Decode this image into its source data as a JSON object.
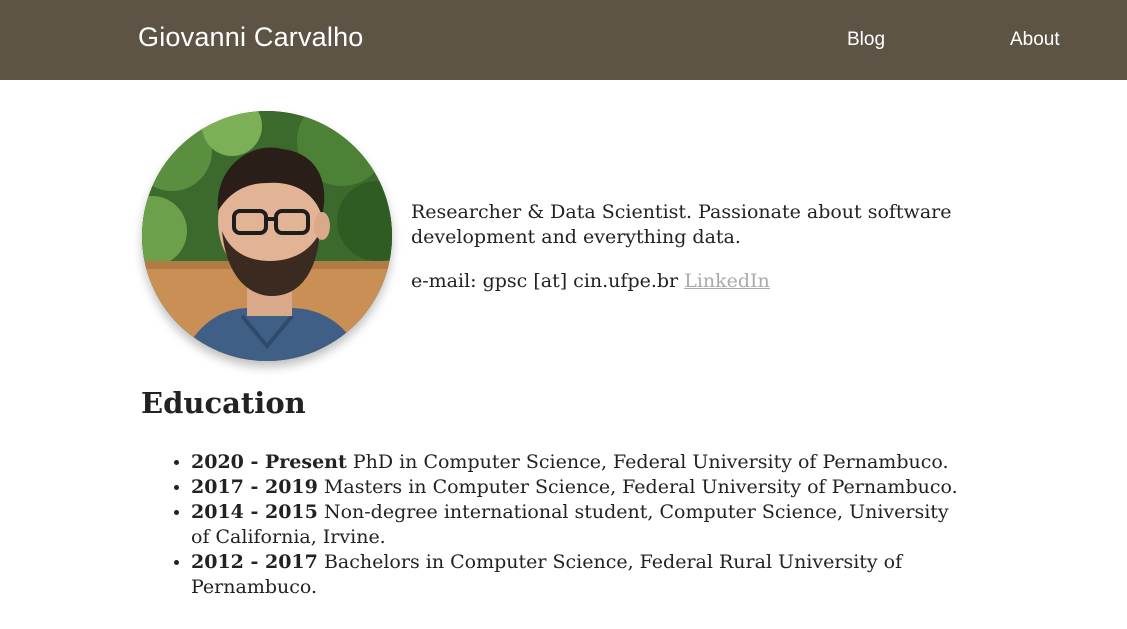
{
  "header": {
    "site_title": "Giovanni Carvalho",
    "nav": [
      {
        "label": "Blog"
      },
      {
        "label": "About"
      }
    ],
    "background_color": "#5e5446"
  },
  "profile": {
    "photo_alt": "Portrait photo of Giovanni Carvalho",
    "tagline": "Researcher & Data Scientist. Passionate about software development and everything data.",
    "email_text": "e-mail: gpsc [at] cin.ufpe.br",
    "linkedin_label": "LinkedIn"
  },
  "education": {
    "heading": "Education",
    "items": [
      {
        "period": "2020 - Present",
        "text": "PhD in Computer Science, Federal University of Pernambuco."
      },
      {
        "period": "2017 - 2019",
        "text": "Masters in Computer Science, Federal University of Pernambuco."
      },
      {
        "period": "2014 - 2015",
        "text": "Non-degree international student, Computer Science, University of California, Irvine."
      },
      {
        "period": "2012 - 2017",
        "text": "Bachelors in Computer Science, Federal Rural University of Pernambuco."
      }
    ]
  },
  "colors": {
    "link_muted": "#aaaaaa",
    "text": "#222222"
  }
}
